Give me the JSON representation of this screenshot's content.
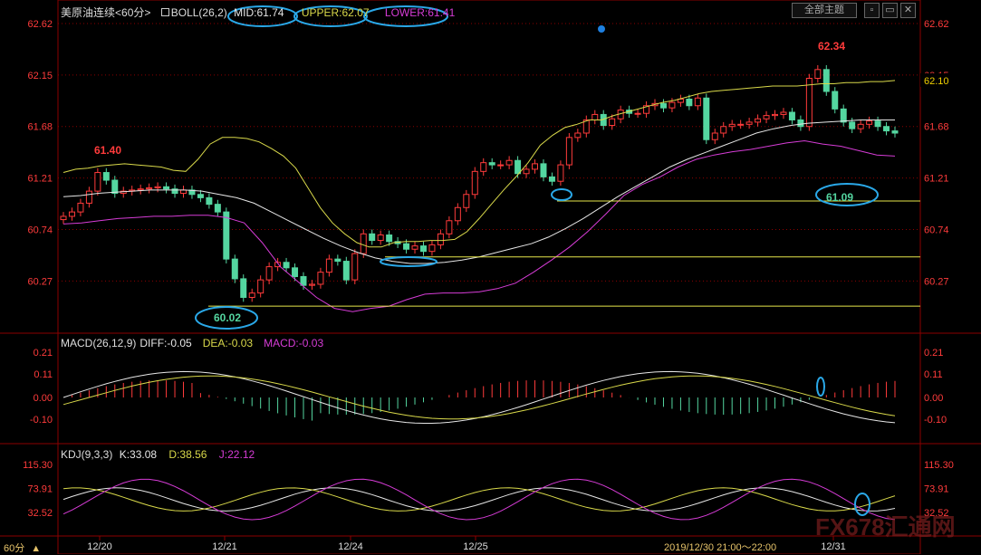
{
  "header": {
    "title": "美原油连续",
    "period": "<60分>",
    "ind": "BOLL(26,2)",
    "mid": "MID:61.74",
    "upper": "UPPER:62.07",
    "lower": "LOWER:61.41",
    "theme_button": "全部主题"
  },
  "macd_header": {
    "name": "MACD(26,12,9)",
    "diff": "DIFF:-0.05",
    "dea": "DEA:-0.03",
    "macd": "MACD:-0.03"
  },
  "kdj_header": {
    "name": "KDJ(9,3,3)",
    "k": "K:33.08",
    "d": "D:38.56",
    "j": "J:22.12"
  },
  "bottom": {
    "period": "60分",
    "crosshair": "2019/12/30 21:00～22:00"
  },
  "watermark": "FX678汇通网",
  "colors": {
    "up": "#ff3b3b",
    "down": "#54d6a0",
    "upper": "#d9d94a",
    "mid": "#e6e6e6",
    "lower": "#d63cd6",
    "axis": "#ff3b3b",
    "grid": "#8b0000"
  },
  "chart_data": {
    "type": "candlestick",
    "price_axis": {
      "ticks": [
        62.62,
        62.15,
        61.68,
        61.21,
        60.74,
        60.27
      ],
      "ylim": [
        60.0,
        62.7
      ]
    },
    "right_label": "62.10",
    "x_ticks": [
      "12/20",
      "12/21",
      "12/24",
      "12/25",
      "12/31"
    ],
    "annotations": [
      {
        "text": "61.40",
        "price": 61.4
      },
      {
        "text": "62.34",
        "price": 62.34
      },
      {
        "text": "60.02",
        "price": 60.02
      },
      {
        "text": "61.09",
        "price": 61.09
      }
    ],
    "horizontal_lines": [
      61.0,
      60.49,
      60.04
    ],
    "closes": [
      60.86,
      60.9,
      60.98,
      61.09,
      61.26,
      61.19,
      61.07,
      61.09,
      61.1,
      61.11,
      61.12,
      61.13,
      61.11,
      61.07,
      61.1,
      61.06,
      61.03,
      60.97,
      60.9,
      60.47,
      60.29,
      60.12,
      60.16,
      60.28,
      60.4,
      60.44,
      60.39,
      60.31,
      60.23,
      60.24,
      60.35,
      60.47,
      60.45,
      60.28,
      60.52,
      60.7,
      60.64,
      60.69,
      60.63,
      60.61,
      60.56,
      60.59,
      60.54,
      60.6,
      60.7,
      60.82,
      60.94,
      61.06,
      61.27,
      61.35,
      61.33,
      61.33,
      61.37,
      61.25,
      61.29,
      61.34,
      61.22,
      61.18,
      61.33,
      61.58,
      61.62,
      61.74,
      61.79,
      61.69,
      61.75,
      61.83,
      61.8,
      61.8,
      61.87,
      61.89,
      61.85,
      61.9,
      61.93,
      61.87,
      61.94,
      61.56,
      61.62,
      61.68,
      61.7,
      61.7,
      61.72,
      61.75,
      61.78,
      61.79,
      61.81,
      61.74,
      61.68,
      62.12,
      62.2,
      62.0,
      61.84,
      61.72,
      61.66,
      61.7,
      61.73,
      61.68,
      61.64,
      61.62
    ],
    "boll_upper": [
      61.26,
      61.29,
      61.3,
      61.32,
      61.33,
      61.34,
      61.33,
      61.32,
      61.31,
      61.28,
      61.27,
      61.38,
      61.52,
      61.58,
      61.58,
      61.57,
      61.54,
      61.48,
      61.41,
      61.3,
      61.12,
      60.94,
      60.8,
      60.7,
      60.62,
      60.58,
      60.58,
      60.62,
      60.63,
      60.63,
      60.64,
      60.64,
      60.65,
      60.72,
      60.84,
      60.97,
      61.1,
      61.22,
      61.35,
      61.51,
      61.6,
      61.67,
      61.7,
      61.74,
      61.74,
      61.78,
      61.81,
      61.84,
      61.87,
      61.9,
      61.92,
      61.95,
      61.98,
      62.0,
      62.01,
      62.02,
      62.03,
      62.04,
      62.05,
      62.05,
      62.05,
      62.06,
      62.07,
      62.07,
      62.08,
      62.08,
      62.09,
      62.09,
      62.1
    ],
    "boll_mid": [
      61.04,
      61.05,
      61.07,
      61.08,
      61.09,
      61.1,
      61.1,
      61.1,
      61.09,
      61.06,
      61.03,
      60.98,
      60.9,
      60.82,
      60.74,
      60.66,
      60.59,
      60.53,
      60.48,
      60.45,
      60.43,
      60.43,
      60.44,
      60.46,
      60.49,
      60.53,
      60.57,
      60.61,
      60.67,
      60.75,
      60.84,
      60.94,
      61.04,
      61.13,
      61.22,
      61.31,
      61.38,
      61.44,
      61.5,
      61.56,
      61.62,
      61.66,
      61.69,
      61.71,
      61.72,
      61.73,
      61.74,
      61.74,
      61.74
    ],
    "boll_lower": [
      60.79,
      60.8,
      60.82,
      60.84,
      60.85,
      60.86,
      60.86,
      60.87,
      60.87,
      60.85,
      60.8,
      60.62,
      60.4,
      60.26,
      60.12,
      60.02,
      59.99,
      60.02,
      60.04,
      60.1,
      60.15,
      60.16,
      60.16,
      60.17,
      60.2,
      60.25,
      60.35,
      60.46,
      60.58,
      60.72,
      60.88,
      61.05,
      61.15,
      61.22,
      61.31,
      61.38,
      61.42,
      61.45,
      61.47,
      61.5,
      61.53,
      61.55,
      61.52,
      61.5,
      61.46,
      61.42,
      61.41
    ],
    "macd": {
      "ticks": [
        0.21,
        0.11,
        0.0,
        -0.1
      ],
      "diff": -0.05,
      "dea": -0.03,
      "macd": -0.03
    },
    "kdj": {
      "ticks": [
        115.3,
        73.91,
        32.52
      ],
      "k": 33.08,
      "d": 38.56,
      "j": 22.12
    }
  }
}
